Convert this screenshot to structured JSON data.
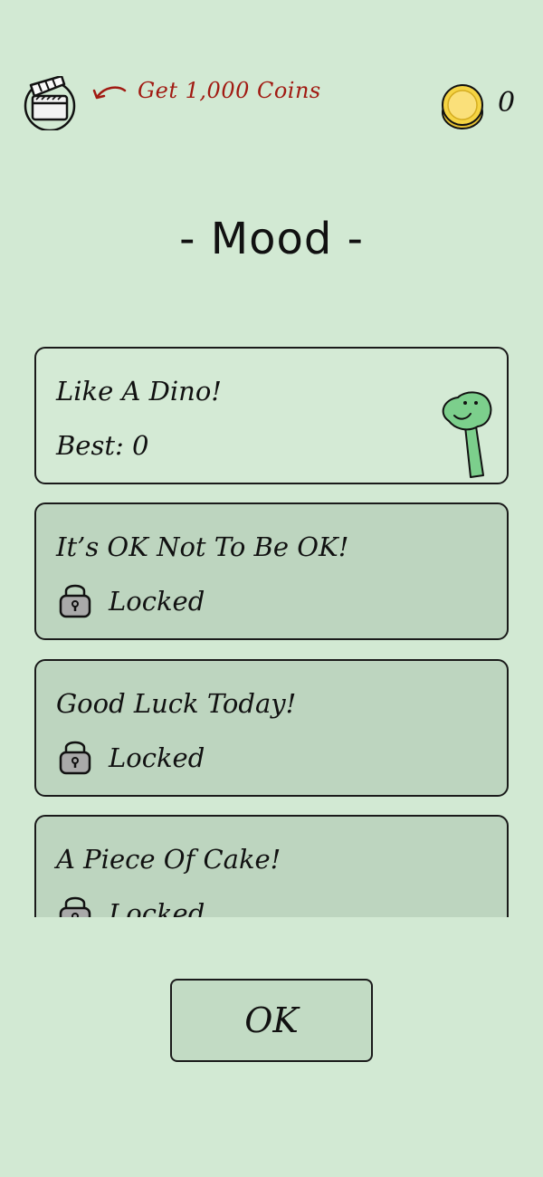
{
  "header": {
    "ad_icon": "clapperboard-icon",
    "ad_label": "Get 1,000 Coins",
    "arrow_icon": "curved-arrow-icon",
    "coin_icon": "gold-coin-icon",
    "coin_count": "0"
  },
  "title": "- Mood -",
  "moods": [
    {
      "title": "Like A Dino!",
      "status": "Best: 0",
      "locked": false,
      "icon": "dino-icon"
    },
    {
      "title": "It’s OK Not To Be OK!",
      "status": "Locked",
      "locked": true,
      "icon": "lock-icon"
    },
    {
      "title": "Good Luck Today!",
      "status": "Locked",
      "locked": true,
      "icon": "lock-icon"
    },
    {
      "title": "A Piece Of Cake!",
      "status": "Locked",
      "locked": true,
      "icon": "lock-icon"
    }
  ],
  "ok_label": "OK",
  "colors": {
    "background": "#d2e9d3",
    "locked_card": "#bdd5bf",
    "ad_text": "#a11a12",
    "dino": "#7ccf8c",
    "coin": "#f5d443"
  }
}
